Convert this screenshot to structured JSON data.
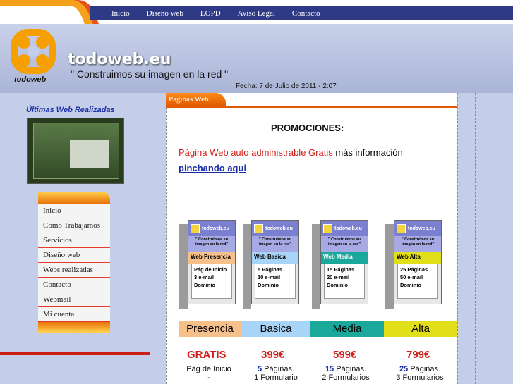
{
  "nav": [
    "Inicio",
    "Diseño web",
    "LOPD",
    "Aviso Legal",
    "Contacto"
  ],
  "brand": {
    "name": "todoweb.eu",
    "slogan": "\" Construimos su imagen en la red \"",
    "logo_text": "todoweb",
    "fecha": "Fecha: 7 de Julio de 2011 - 2:07"
  },
  "left": {
    "recent_title": "Últimas Web Realizadas",
    "menu": [
      "Inicio",
      "Como Trabajamos",
      "Servicios",
      "Diseño web",
      "Webs realizadas",
      "Contacto",
      "Webmail",
      "Mi cuenta"
    ]
  },
  "content": {
    "tab": "Paginas Web",
    "promo_title": "PROMOCIONES:",
    "promo_red": "Página Web auto administrable Gratis",
    "promo_rest": " más información",
    "promo_link": "pinchando aqui",
    "boxes": [
      {
        "brand": "todoweb.eu",
        "sub": "\" Construimos su imagen en la red\"",
        "tier": "Web Presencia",
        "feats": [
          "Pág de Inicio",
          "3 e-mail",
          "Dominio"
        ]
      },
      {
        "brand": "todoweb.eu",
        "sub": "\" Construimos su imagen en la red\"",
        "tier": "Web Basica",
        "feats": [
          "5 Páginas",
          "10 e-mail",
          "Dominio"
        ]
      },
      {
        "brand": "todoweb.eu",
        "sub": "\" Construimos su imagen en la red\"",
        "tier": "Web Media",
        "feats": [
          "15 Páginas",
          "20 e-mail",
          "Dominio"
        ]
      },
      {
        "brand": "todoweb.eu",
        "sub": "\" Construimos su imagen en la red\"",
        "tier": "Web Alta",
        "feats": [
          "25 Páginas",
          "50 e-mail",
          "Dominio"
        ]
      }
    ],
    "plans": [
      {
        "name": "Presencia",
        "price": "GRATIS",
        "l1": "Pág de Inicio",
        "l1num": "",
        "l2": "-"
      },
      {
        "name": "Basica",
        "price": "399€",
        "l1": " Páginas.",
        "l1num": "5",
        "l2": "1 Formulario"
      },
      {
        "name": "Media",
        "price": "599€",
        "l1": " Páginas.",
        "l1num": "15",
        "l2": "2 Formularios"
      },
      {
        "name": "Alta",
        "price": "799€",
        "l1": " Páginas.",
        "l1num": "25",
        "l2": "3 Formularios"
      }
    ]
  }
}
